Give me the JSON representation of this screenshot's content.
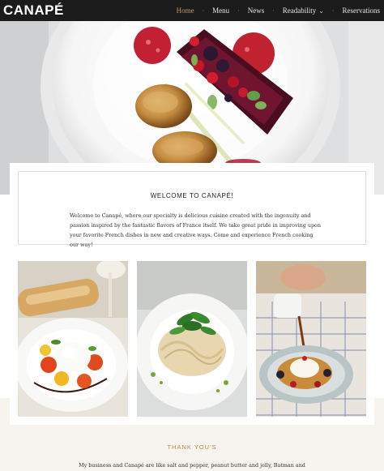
{
  "nav": {
    "logo": "CANAPÉ",
    "items": [
      {
        "label": "Home"
      },
      {
        "label": "Menu"
      },
      {
        "label": "News"
      },
      {
        "label": "Readability"
      },
      {
        "label": "Reservations"
      }
    ],
    "active_color": "#c49a5b"
  },
  "welcome": {
    "title": "WELCOME TO CANAPÉ!",
    "body": "Welcome to Canapé, where our specialty is delicious cuisine created with the ingenuity and passion inspired by the fantastic flavors of France itself. We take great pride in improving upon your favorite French dishes in new and creative ways. Come and experience French cooking our way!"
  },
  "thanks": {
    "title": "THANK YOU'S",
    "body": "My business and Canapé are like salt and pepper, peanut butter and jelly, Batman and"
  },
  "images": {
    "hero": "plated-scallop-dish",
    "photo1": "mozzarella-salad-plate",
    "photo2": "pasta-with-greens",
    "photo3": "waffles-syrup-pour"
  }
}
